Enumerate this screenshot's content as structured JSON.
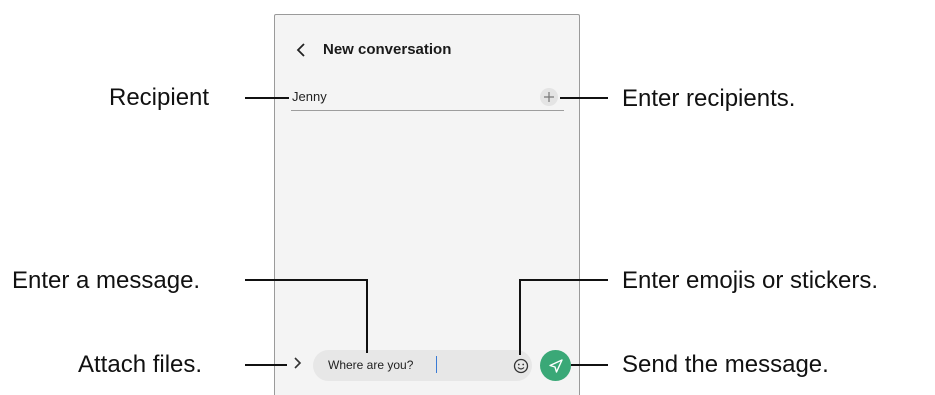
{
  "screen": {
    "title": "New conversation",
    "recipient_value": "Jenny",
    "message_value": "Where are you?"
  },
  "callouts": {
    "recipient": "Recipient",
    "enter_recipients": "Enter recipients.",
    "enter_message": "Enter a message.",
    "enter_emojis": "Enter emojis or stickers.",
    "attach_files": "Attach files.",
    "send_message": "Send the message."
  },
  "icons": {
    "back": "chevron-left-icon",
    "add_recipient": "plus-icon",
    "attach": "chevron-right-icon",
    "emoji": "smiley-icon",
    "send": "paper-plane-icon"
  },
  "colors": {
    "send_button": "#3aa877",
    "input_background": "#e7e7e7",
    "screen_background": "#f4f4f4"
  }
}
